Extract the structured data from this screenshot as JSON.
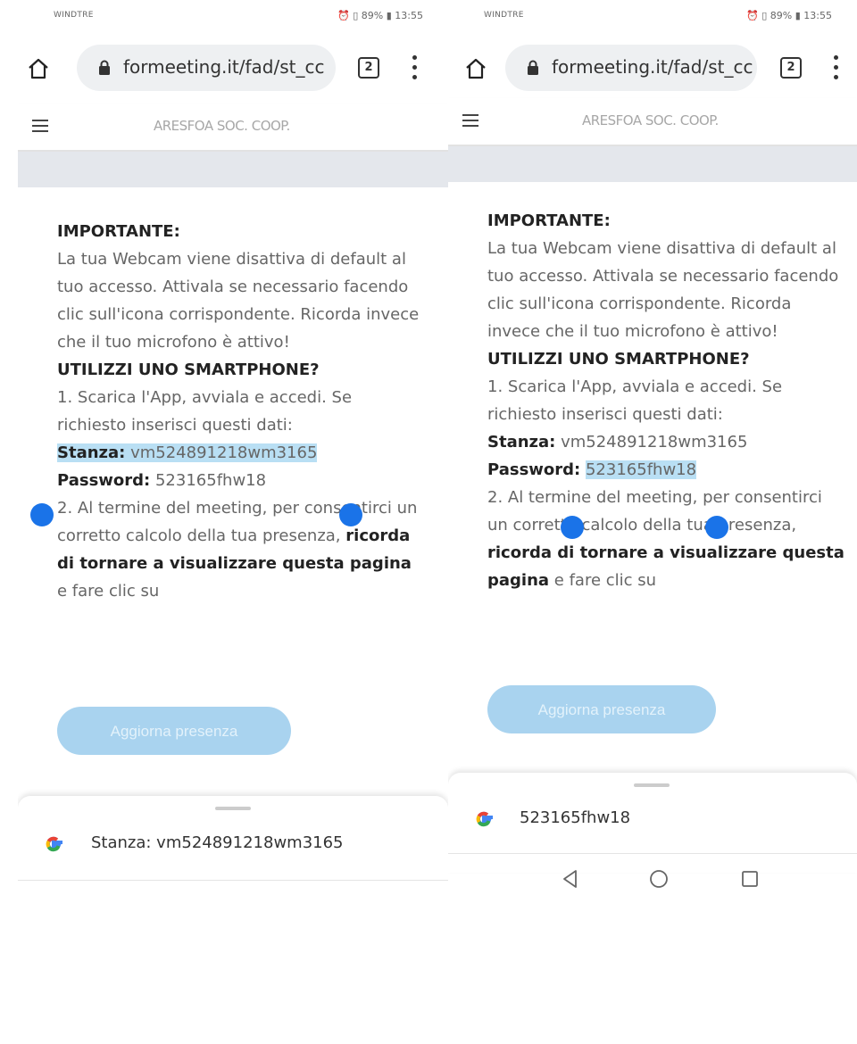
{
  "screens": [
    {
      "status": {
        "carrier": "WINDTRE",
        "right": "⏰ ▯ 89% ▮ 13:55"
      },
      "browser": {
        "url": "formeeting.it/fad/st_cc",
        "tab_count": "2"
      },
      "site": {
        "title": "ARESFOA SOC. COOP."
      },
      "content": {
        "heading_important": "IMPORTANTE:",
        "important_text": "La tua Webcam viene disattiva di default al tuo accesso. Attivala se necessario facendo clic sull'icona corrispondente. Ricorda invece che il tuo microfono è attivo!",
        "heading_smartphone": "UTILIZZI UNO SMARTPHONE?",
        "step1": "1. Scarica l'App, avviala e accedi. Se richiesto inserisci questi dati:",
        "room_label": "Stanza:",
        "room_value": "vm524891218wm3165",
        "password_label": "Password:",
        "password_value": "523165fhw18",
        "step2_start": "2. Al termine del meeting, per consentirci un corretto calcolo della tua presenza,",
        "step2_bold": "ricorda di tornare a visualizzare questa pagina",
        "step2_end": "e fare clic su"
      },
      "button": {
        "label": "Aggiorna presenza"
      },
      "suggestion": {
        "text": "Stanza: vm524891218wm3165"
      }
    },
    {
      "status": {
        "carrier": "WINDTRE",
        "right": "⏰ ▯ 89% ▮ 13:55"
      },
      "browser": {
        "url": "formeeting.it/fad/st_cc",
        "tab_count": "2"
      },
      "site": {
        "title": "ARESFOA SOC. COOP."
      },
      "content": {
        "heading_important": "IMPORTANTE:",
        "important_text": "La tua Webcam viene disattiva di default al tuo accesso. Attivala se necessario facendo clic sull'icona corrispondente. Ricorda invece che il tuo microfono è attivo!",
        "heading_smartphone": "UTILIZZI UNO SMARTPHONE?",
        "step1": "1. Scarica l'App, avviala e accedi. Se richiesto inserisci questi dati:",
        "room_label": "Stanza:",
        "room_value": "vm524891218wm3165",
        "password_label": "Password:",
        "password_value": "523165fhw18",
        "step2_start": "2. Al termine del meeting, per consentirci un corretto calcolo della tua presenza,",
        "step2_bold": "ricorda di tornare a visualizzare questa pagina",
        "step2_end": "e fare clic su"
      },
      "button": {
        "label": "Aggiorna presenza"
      },
      "suggestion": {
        "text": "523165fhw18"
      }
    }
  ]
}
